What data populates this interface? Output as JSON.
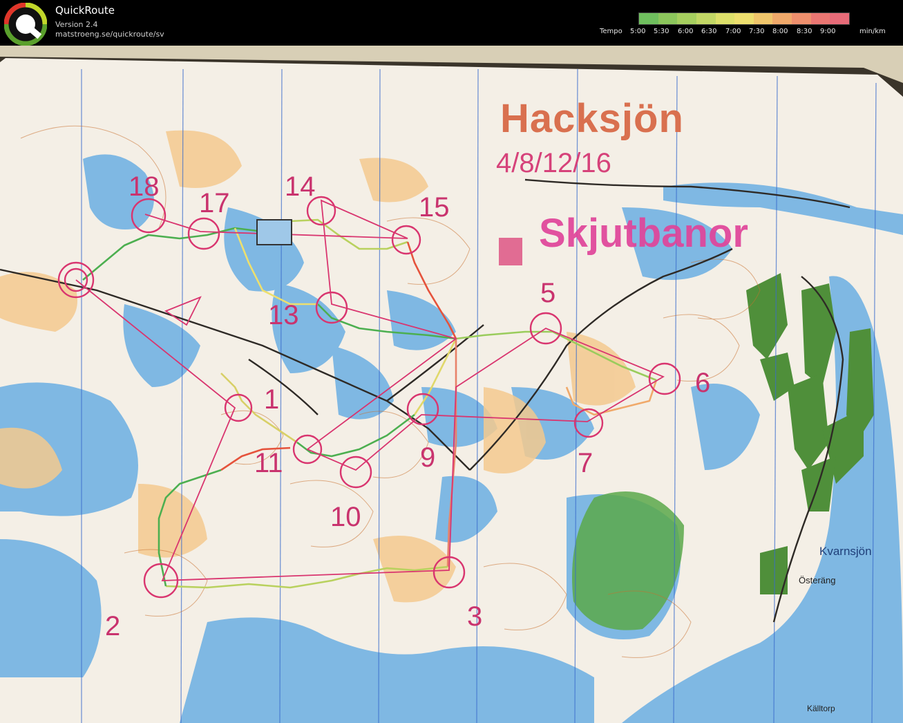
{
  "header": {
    "app_name": "QuickRoute",
    "version": "Version 2.4",
    "url": "matstroeng.se/quickroute/sv",
    "tempo_label": "Tempo",
    "tempo_ticks": [
      "5:00",
      "5:30",
      "6:00",
      "6:30",
      "7:00",
      "7:30",
      "8:00",
      "8:30",
      "9:00"
    ],
    "unit": "min/km",
    "legend_colors": [
      "#6fbf5e",
      "#8cc65c",
      "#a6cf5f",
      "#c2d765",
      "#dde06a",
      "#eddf6e",
      "#f0c66b",
      "#f0a96a",
      "#ee8f6d",
      "#ea7672",
      "#e76b78"
    ]
  },
  "map": {
    "title": "Hacksjön",
    "courses": "4/8/12/16",
    "area_label": "Skjutbanor",
    "controls": [
      {
        "label": "1"
      },
      {
        "label": "2"
      },
      {
        "label": "3"
      },
      {
        "label": "5"
      },
      {
        "label": "6"
      },
      {
        "label": "7"
      },
      {
        "label": "9"
      },
      {
        "label": "10"
      },
      {
        "label": "11"
      },
      {
        "label": "13"
      },
      {
        "label": "14"
      },
      {
        "label": "15"
      },
      {
        "label": "17"
      },
      {
        "label": "18"
      }
    ],
    "places": [
      {
        "name": "Kvarnsjön"
      },
      {
        "name": "Österäng"
      },
      {
        "name": "Källtorp"
      }
    ],
    "colors": {
      "course": "#d9356f",
      "route_fast": "#4caf50",
      "route_slow": "#e5533c",
      "water": "#6fb3e0",
      "open": "#f2c58c",
      "green": "#4f8f3a"
    }
  }
}
